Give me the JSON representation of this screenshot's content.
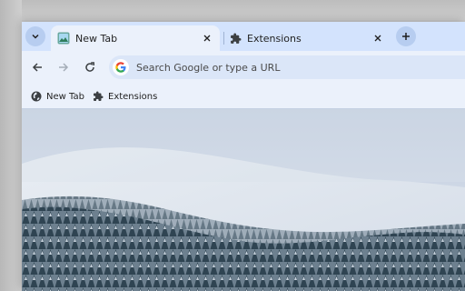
{
  "tabs": [
    {
      "label": "New Tab",
      "active": true,
      "icon": "new-tab-favicon-icon"
    },
    {
      "label": "Extensions",
      "active": false,
      "icon": "puzzle-icon"
    }
  ],
  "omnibox": {
    "placeholder": "Search Google or type a URL",
    "value": ""
  },
  "bookmarks": [
    {
      "label": "New Tab",
      "icon": "globe-icon"
    },
    {
      "label": "Extensions",
      "icon": "puzzle-icon"
    }
  ],
  "colors": {
    "frame": "#d3e3fd",
    "toolbar": "#ebf1fb",
    "accent": "#0b57d0"
  },
  "background_image": "snowy forested hillside under fog"
}
